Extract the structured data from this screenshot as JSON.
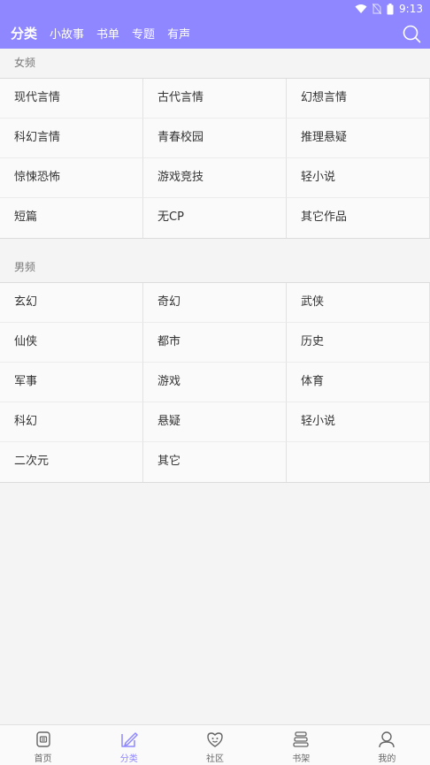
{
  "status": {
    "time": "9:13"
  },
  "header": {
    "tabs": [
      {
        "label": "分类",
        "active": true
      },
      {
        "label": "小故事"
      },
      {
        "label": "书单"
      },
      {
        "label": "专题"
      },
      {
        "label": "有声"
      }
    ],
    "search_icon": "search-icon"
  },
  "sections": [
    {
      "title": "女频",
      "items": [
        "现代言情",
        "古代言情",
        "幻想言情",
        "科幻言情",
        "青春校园",
        "推理悬疑",
        "惊悚恐怖",
        "游戏竞技",
        "轻小说",
        "短篇",
        "无CP",
        "其它作品"
      ]
    },
    {
      "title": "男频",
      "items": [
        "玄幻",
        "奇幻",
        "武侠",
        "仙侠",
        "都市",
        "历史",
        "军事",
        "游戏",
        "体育",
        "科幻",
        "悬疑",
        "轻小说",
        "二次元",
        "其它"
      ]
    }
  ],
  "bottom_nav": [
    {
      "label": "首页",
      "icon": "home-icon"
    },
    {
      "label": "分类",
      "icon": "category-icon",
      "active": true
    },
    {
      "label": "社区",
      "icon": "community-icon"
    },
    {
      "label": "书架",
      "icon": "bookshelf-icon"
    },
    {
      "label": "我的",
      "icon": "profile-icon"
    }
  ],
  "colors": {
    "accent": "#8e87ff",
    "background": "#f4f4f4"
  }
}
